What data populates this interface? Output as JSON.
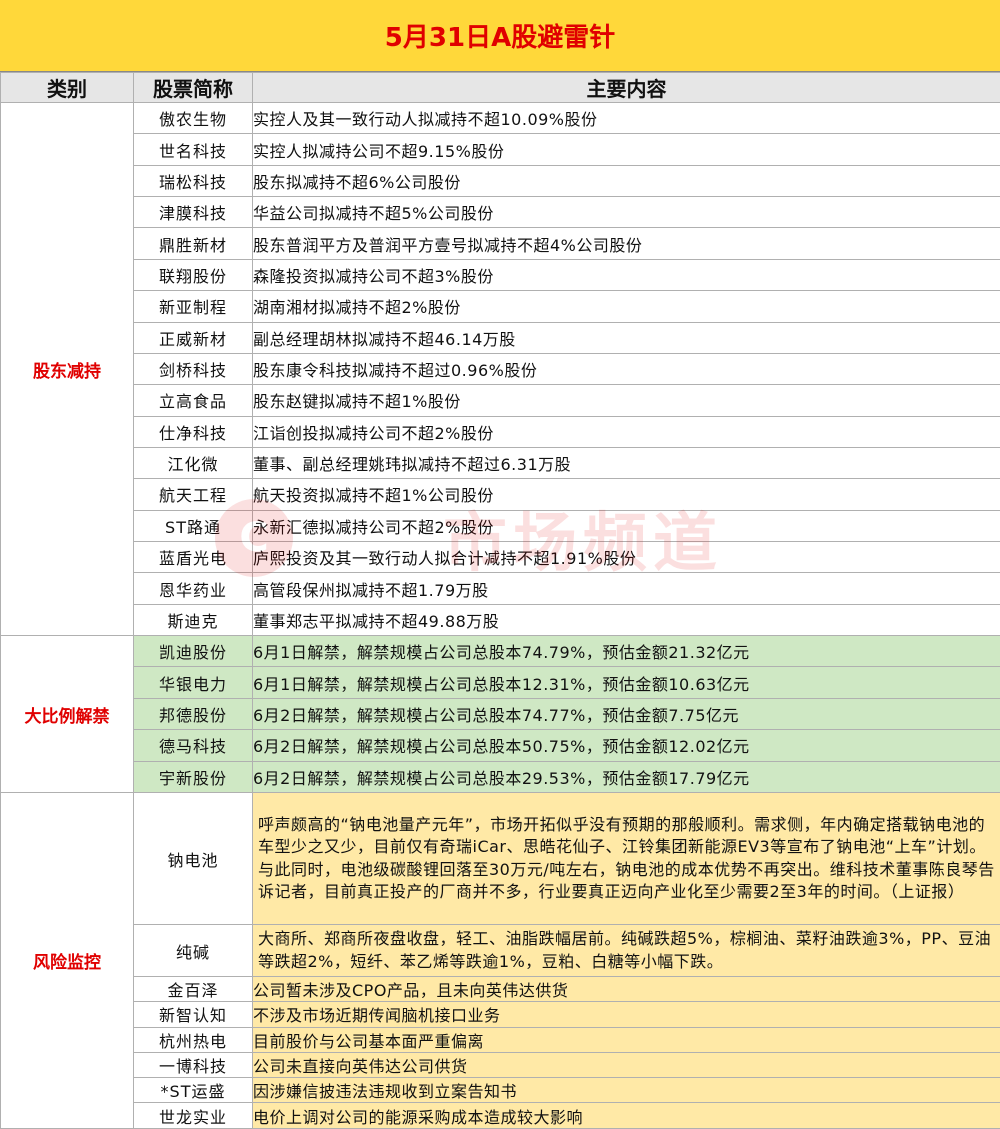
{
  "title": "5月31日A股避雷针",
  "headers": {
    "category": "类别",
    "name": "股票简称",
    "content": "主要内容"
  },
  "groups": [
    {
      "category": "股东减持",
      "rows": [
        {
          "name": "傲农生物",
          "content": "实控人及其一致行动人拟减持不超10.09%股份"
        },
        {
          "name": "世名科技",
          "content": "实控人拟减持公司不超9.15%股份"
        },
        {
          "name": "瑞松科技",
          "content": "股东拟减持不超6%公司股份"
        },
        {
          "name": "津膜科技",
          "content": "华益公司拟减持不超5%公司股份"
        },
        {
          "name": "鼎胜新材",
          "content": "股东普润平方及普润平方壹号拟减持不超4%公司股份"
        },
        {
          "name": "联翔股份",
          "content": "森隆投资拟减持公司不超3%股份"
        },
        {
          "name": "新亚制程",
          "content": "湖南湘材拟减持不超2%股份"
        },
        {
          "name": "正威新材",
          "content": "副总经理胡林拟减持不超46.14万股"
        },
        {
          "name": "剑桥科技",
          "content": "股东康令科技拟减持不超过0.96%股份"
        },
        {
          "name": "立高食品",
          "content": "股东赵键拟减持不超1%股份"
        },
        {
          "name": "仕净科技",
          "content": "江诣创投拟减持公司不超2%股份"
        },
        {
          "name": "江化微",
          "content": "董事、副总经理姚玮拟减持不超过6.31万股"
        },
        {
          "name": "航天工程",
          "content": "航天投资拟减持不超1%公司股份"
        },
        {
          "name": "ST路通",
          "content": "永新汇德拟减持公司不超2%股份"
        },
        {
          "name": "蓝盾光电",
          "content": "庐熙投资及其一致行动人拟合计减持不超1.91%股份"
        },
        {
          "name": "恩华药业",
          "content": "高管段保州拟减持不超1.79万股"
        },
        {
          "name": "斯迪克",
          "content": "董事郑志平拟减持不超49.88万股"
        }
      ]
    },
    {
      "category": "大比例解禁",
      "rows": [
        {
          "name": "凯迪股份",
          "content": "6月1日解禁，解禁规模占公司总股本74.79%，预估金额21.32亿元"
        },
        {
          "name": "华银电力",
          "content": "6月1日解禁，解禁规模占公司总股本12.31%，预估金额10.63亿元"
        },
        {
          "name": "邦德股份",
          "content": "6月2日解禁，解禁规模占公司总股本74.77%，预估金额7.75亿元"
        },
        {
          "name": "德马科技",
          "content": "6月2日解禁，解禁规模占公司总股本50.75%，预估金额12.02亿元"
        },
        {
          "name": "宇新股份",
          "content": "6月2日解禁，解禁规模占公司总股本29.53%，预估金额17.79亿元"
        }
      ]
    },
    {
      "category": "风险监控",
      "rows": [
        {
          "name": "钠电池",
          "content": "呼声颇高的“钠电池量产元年”，市场开拓似乎没有预期的那般顺利。需求侧，年内确定搭载钠电池的车型少之又少，目前仅有奇瑞iCar、思皓花仙子、江铃集团新能源EV3等宣布了钠电池“上车”计划。与此同时，电池级碳酸锂回落至30万元/吨左右，钠电池的成本优势不再突出。维科技术董事陈良琴告诉记者，目前真正投产的厂商并不多，行业要真正迈向产业化至少需要2至3年的时间。（上证报）"
        },
        {
          "name": "纯碱",
          "content": "大商所、郑商所夜盘收盘，轻工、油脂跌幅居前。纯碱跌超5%，棕榈油、菜籽油跌逾3%，PP、豆油等跌超2%，短纤、苯乙烯等跌逾1%，豆粕、白糖等小幅下跌。"
        },
        {
          "name": "金百泽",
          "content": "公司暂未涉及CPO产品，且未向英伟达供货"
        },
        {
          "name": "新智认知",
          "content": "不涉及市场近期传闻脑机接口业务"
        },
        {
          "name": "杭州热电",
          "content": "目前股价与公司基本面严重偏离"
        },
        {
          "name": "一博科技",
          "content": "公司未直接向英伟达公司供货"
        },
        {
          "name": "*ST运盛",
          "content": "因涉嫌信披违法违规收到立案告知书"
        },
        {
          "name": "世龙实业",
          "content": "电价上调对公司的能源采购成本造成较大影响"
        }
      ]
    }
  ],
  "watermark": {
    "text": "市场频道",
    "logo": "C"
  },
  "colors": {
    "title_bg": "#ffd83a",
    "title_text": "#e00000",
    "unlock_bg": "#cfe8c4",
    "risk_bg": "#ffe9a6",
    "category_text": "#e00000"
  }
}
